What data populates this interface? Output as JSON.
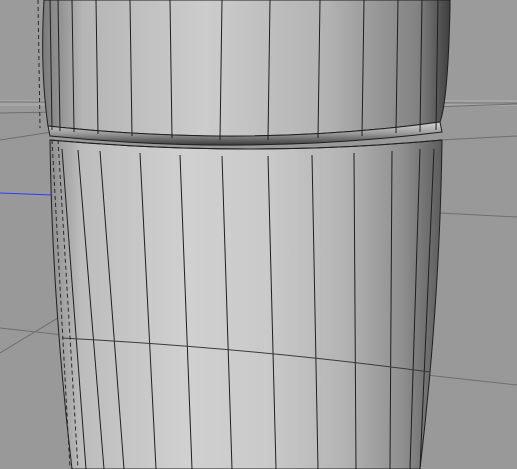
{
  "viewport": {
    "view": "perspective",
    "background_color": "#9a9a9a",
    "horizon_color": "#a4a4a4",
    "grid_color": "#6d6d6d",
    "x_axis_color": "#2f3bff",
    "wireframe_color": "#1f1f1f",
    "object": {
      "type": "cylinder",
      "shading": "gouraud-with-wireframe",
      "base_color": "#bdbdbd"
    }
  }
}
